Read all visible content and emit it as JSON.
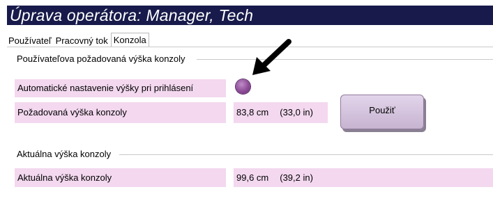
{
  "window": {
    "title": "Úprava operátora: Manager, Tech"
  },
  "tabs": [
    {
      "label": "Používateľ",
      "active": false
    },
    {
      "label": "Pracovný tok",
      "active": false
    },
    {
      "label": "Konzola",
      "active": true
    }
  ],
  "requested_section": {
    "title": "Používateľova požadovaná výška konzoly",
    "auto_height_label": "Automatické nastavenie výšky pri prihlásení",
    "auto_height_control": "radio-button",
    "requested_height_label": "Požadovaná výška konzoly",
    "requested_height_cm": "83,8 cm",
    "requested_height_in": "(33,0 in)",
    "apply_button": "Použiť"
  },
  "current_section": {
    "title": "Aktuálna výška konzoly",
    "current_height_label": "Aktuálna výška konzoly",
    "current_height_cm": "99,6 cm",
    "current_height_in": "(39,2 in)"
  },
  "colors": {
    "title_bar_bg": "#171a4a",
    "cell_bg": "#f3d8ef",
    "radio": "#8c4c96",
    "button_bg": "#d6c6de"
  },
  "annotation": {
    "icon": "pointer-arrow-icon"
  }
}
